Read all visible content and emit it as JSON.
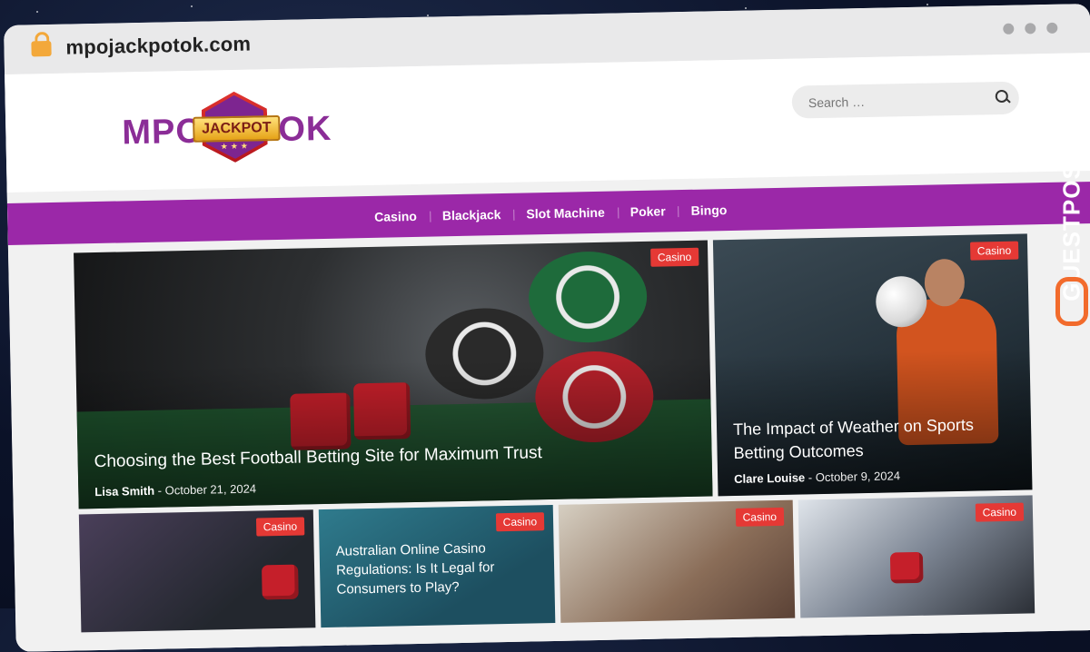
{
  "browser": {
    "url": "mpojackpotok.com"
  },
  "logo": {
    "left_text": "MPO",
    "badge_text": "JACKPOT",
    "right_text": "OK"
  },
  "search": {
    "placeholder": "Search …"
  },
  "nav": {
    "items": [
      "Casino",
      "Blackjack",
      "Slot Machine",
      "Poker",
      "Bingo"
    ]
  },
  "featured": [
    {
      "category": "Casino",
      "title": "Choosing the Best Football Betting Site for Maximum Trust",
      "author": "Lisa Smith",
      "date": "October 21, 2024"
    },
    {
      "category": "Casino",
      "title": "The Impact of Weather on Sports Betting Outcomes",
      "author": "Clare Louise",
      "date": "October 9, 2024"
    }
  ],
  "small_posts": [
    {
      "category": "Casino",
      "title": ""
    },
    {
      "category": "Casino",
      "title": "Australian Online Casino Regulations: Is It Legal for Consumers to Play?"
    },
    {
      "category": "Casino",
      "title": ""
    },
    {
      "category": "Casino",
      "title": ""
    }
  ],
  "watermark": {
    "text": "GUESTPOSTLINKS"
  },
  "colors": {
    "nav_bg": "#9b28a8",
    "tag_bg": "#e53935",
    "logo_purple": "#8b2d97",
    "lock": "#f3a83a"
  }
}
